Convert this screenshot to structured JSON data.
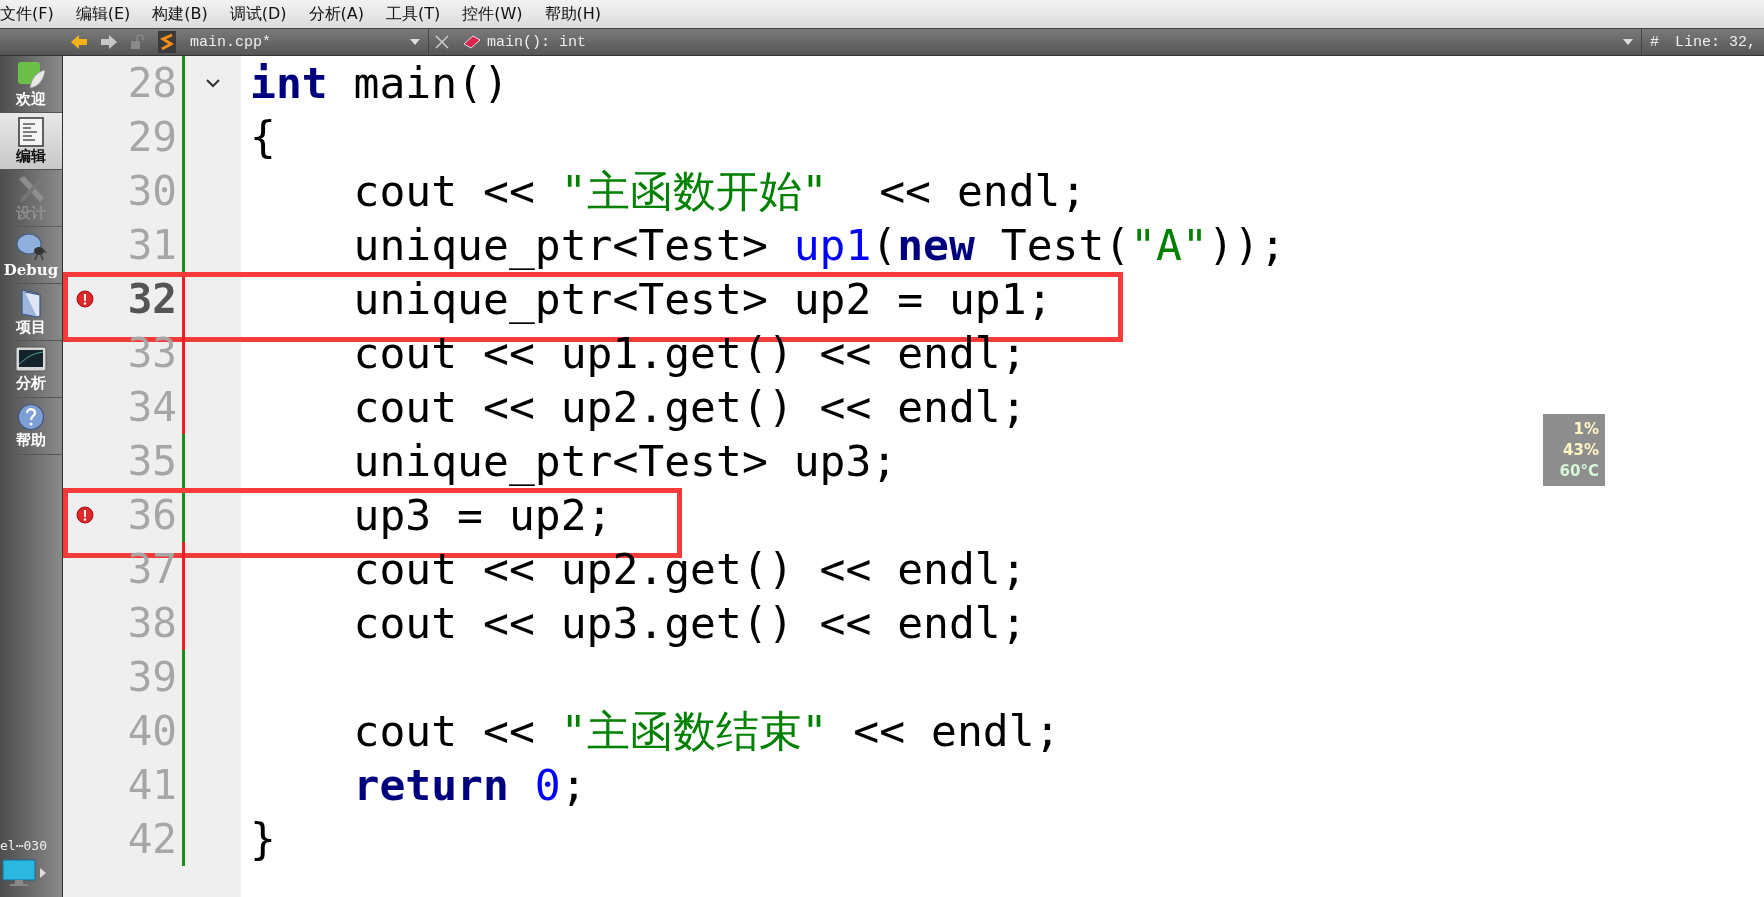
{
  "menu_bar": [
    {
      "label": "文件(F)"
    },
    {
      "label": "编辑(E)"
    },
    {
      "label": "构建(B)"
    },
    {
      "label": "调试(D)"
    },
    {
      "label": "分析(A)"
    },
    {
      "label": "工具(T)"
    },
    {
      "label": "控件(W)"
    },
    {
      "label": "帮助(H)"
    }
  ],
  "toolbar": {
    "file": "main.cpp*",
    "symbol": "main(): int",
    "position_marker": "#",
    "position": "Line: 32,"
  },
  "sidebar": {
    "items": [
      {
        "label": "欢迎",
        "kind": "welcome",
        "selected": false,
        "disabled": false
      },
      {
        "label": "编辑",
        "kind": "edit",
        "selected": true,
        "disabled": false
      },
      {
        "label": "设计",
        "kind": "design",
        "selected": false,
        "disabled": true
      },
      {
        "label": "Debug",
        "kind": "debug",
        "selected": false,
        "disabled": false
      },
      {
        "label": "项目",
        "kind": "projects",
        "selected": false,
        "disabled": false
      },
      {
        "label": "分析",
        "kind": "analyze",
        "selected": false,
        "disabled": false
      },
      {
        "label": "帮助",
        "kind": "help",
        "selected": false,
        "disabled": false
      }
    ],
    "footer_label": "el⋯030"
  },
  "editor": {
    "lines": [
      {
        "number": "28",
        "foldable": true,
        "breakpoint": false,
        "current": false,
        "modified": false,
        "annotated": false,
        "tokens": [
          {
            "kind": "keyword",
            "text": "int"
          },
          {
            "kind": "plain",
            "text": " main()"
          }
        ]
      },
      {
        "number": "29",
        "foldable": false,
        "breakpoint": false,
        "current": false,
        "modified": false,
        "annotated": false,
        "tokens": [
          {
            "kind": "plain",
            "text": "{"
          }
        ]
      },
      {
        "number": "30",
        "foldable": false,
        "breakpoint": false,
        "current": false,
        "modified": false,
        "annotated": false,
        "tokens": [
          {
            "kind": "plain",
            "text": "    cout << "
          },
          {
            "kind": "string",
            "text": "\"主函数开始\""
          },
          {
            "kind": "plain",
            "text": "  << endl;"
          }
        ]
      },
      {
        "number": "31",
        "foldable": false,
        "breakpoint": false,
        "current": false,
        "modified": false,
        "annotated": false,
        "tokens": [
          {
            "kind": "plain",
            "text": "    unique_ptr<Test> "
          },
          {
            "kind": "variable",
            "text": "up1"
          },
          {
            "kind": "plain",
            "text": "("
          },
          {
            "kind": "keyword",
            "text": "new"
          },
          {
            "kind": "plain",
            "text": " Test("
          },
          {
            "kind": "string",
            "text": "\"A\""
          },
          {
            "kind": "plain",
            "text": "));"
          }
        ]
      },
      {
        "number": "32",
        "foldable": false,
        "breakpoint": true,
        "current": true,
        "modified": true,
        "annotated": true,
        "tokens": [
          {
            "kind": "plain",
            "text": "    unique_ptr<Test> up2 = up1;"
          }
        ]
      },
      {
        "number": "33",
        "foldable": false,
        "breakpoint": false,
        "current": false,
        "modified": true,
        "annotated": false,
        "tokens": [
          {
            "kind": "plain",
            "text": "    cout << up1.get() << endl;"
          }
        ]
      },
      {
        "number": "34",
        "foldable": false,
        "breakpoint": false,
        "current": false,
        "modified": true,
        "annotated": false,
        "tokens": [
          {
            "kind": "plain",
            "text": "    cout << up2.get() << endl;"
          }
        ]
      },
      {
        "number": "35",
        "foldable": false,
        "breakpoint": false,
        "current": false,
        "modified": false,
        "annotated": false,
        "tokens": [
          {
            "kind": "plain",
            "text": "    unique_ptr<Test> up3;"
          }
        ]
      },
      {
        "number": "36",
        "foldable": false,
        "breakpoint": true,
        "current": false,
        "modified": false,
        "annotated": true,
        "tokens": [
          {
            "kind": "plain",
            "text": "    up3 = up2;"
          }
        ]
      },
      {
        "number": "37",
        "foldable": false,
        "breakpoint": false,
        "current": false,
        "modified": true,
        "annotated": false,
        "tokens": [
          {
            "kind": "plain",
            "text": "    cout << up2.get() << endl;"
          }
        ]
      },
      {
        "number": "38",
        "foldable": false,
        "breakpoint": false,
        "current": false,
        "modified": true,
        "annotated": false,
        "tokens": [
          {
            "kind": "plain",
            "text": "    cout << up3.get() << endl;"
          }
        ]
      },
      {
        "number": "39",
        "foldable": false,
        "breakpoint": false,
        "current": false,
        "modified": false,
        "annotated": false
      },
      {
        "number": "40",
        "foldable": false,
        "breakpoint": false,
        "current": false,
        "modified": false,
        "annotated": false,
        "tokens": [
          {
            "kind": "plain",
            "text": "    cout << "
          },
          {
            "kind": "string",
            "text": "\"主函数结束\""
          },
          {
            "kind": "plain",
            "text": " << endl;"
          }
        ]
      },
      {
        "number": "41",
        "foldable": false,
        "breakpoint": false,
        "current": false,
        "modified": false,
        "annotated": false,
        "tokens": [
          {
            "kind": "keyword",
            "text": "    return "
          },
          {
            "kind": "number",
            "text": "0"
          },
          {
            "kind": "plain",
            "text": ";"
          }
        ]
      },
      {
        "number": "42",
        "foldable": false,
        "breakpoint": false,
        "current": false,
        "modified": false,
        "annotated": false,
        "tokens": [
          {
            "kind": "plain",
            "text": "}"
          }
        ]
      }
    ]
  },
  "system_monitor": [
    {
      "text": "1%",
      "color": "#fff6c4"
    },
    {
      "text": "43%",
      "color": "#fff6c4"
    },
    {
      "text": "60°C",
      "color": "#d6f7d6"
    }
  ]
}
